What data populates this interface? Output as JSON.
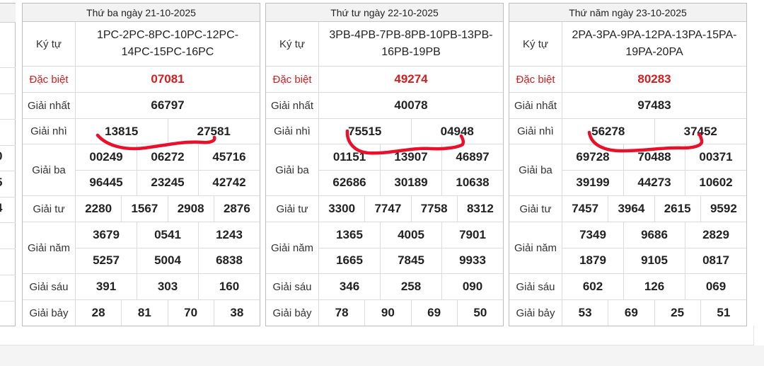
{
  "row_labels": {
    "kytu": "Ký tự",
    "db": "Đặc biệt",
    "g1": "Giải nhất",
    "g2": "Giải nhì",
    "g3": "Giải ba",
    "g4": "Giải tư",
    "g5": "Giải năm",
    "g6": "Giải sáu",
    "g7": "Giải bảy"
  },
  "partial_digits": [
    "0",
    "5",
    "4"
  ],
  "tickets": [
    {
      "date": "Thứ ba ngày 21-10-2025",
      "kytu": "1PC-2PC-8PC-10PC-12PC-14PC-15PC-16PC",
      "db": "07081",
      "g1": "66797",
      "g2": [
        "13815",
        "27581"
      ],
      "g3": [
        [
          "00249",
          "06272",
          "45716"
        ],
        [
          "96445",
          "23245",
          "42742"
        ]
      ],
      "g4": [
        "2280",
        "1567",
        "2908",
        "2876"
      ],
      "g5": [
        [
          "3679",
          "0541",
          "1243"
        ],
        [
          "5257",
          "5004",
          "6838"
        ]
      ],
      "g6": [
        "391",
        "303",
        "160"
      ],
      "g7": [
        "28",
        "81",
        "70",
        "38"
      ]
    },
    {
      "date": "Thứ tư ngày 22-10-2025",
      "kytu": "3PB-4PB-7PB-8PB-10PB-13PB-16PB-19PB",
      "db": "49274",
      "g1": "40078",
      "g2": [
        "75515",
        "04948"
      ],
      "g3": [
        [
          "01151",
          "13907",
          "46897"
        ],
        [
          "62686",
          "30189",
          "10638"
        ]
      ],
      "g4": [
        "3300",
        "7747",
        "7758",
        "8312"
      ],
      "g5": [
        [
          "1365",
          "4005",
          "7901"
        ],
        [
          "1665",
          "7845",
          "9933"
        ]
      ],
      "g6": [
        "346",
        "258",
        "090"
      ],
      "g7": [
        "78",
        "90",
        "69",
        "50"
      ]
    },
    {
      "date": "Thứ năm ngày 23-10-2025",
      "kytu": "2PA-3PA-9PA-12PA-13PA-15PA-19PA-20PA",
      "db": "80283",
      "g1": "97483",
      "g2": [
        "56278",
        "37452"
      ],
      "g3": [
        [
          "69728",
          "70488",
          "00371"
        ],
        [
          "39199",
          "44273",
          "10602"
        ]
      ],
      "g4": [
        "7457",
        "3964",
        "2615",
        "9592"
      ],
      "g5": [
        [
          "7349",
          "9686",
          "2829"
        ],
        [
          "1879",
          "9105",
          "0817"
        ]
      ],
      "g6": [
        "602",
        "126",
        "069"
      ],
      "g7": [
        "53",
        "69",
        "25",
        "51"
      ]
    }
  ],
  "colors": {
    "accent_red": "#d21f1f",
    "scribble": "#e8102a"
  }
}
